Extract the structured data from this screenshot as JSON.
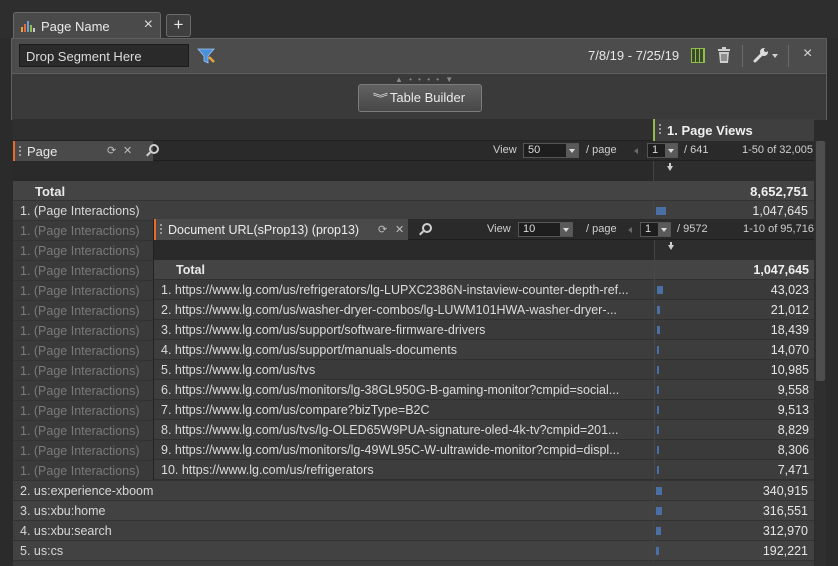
{
  "tab": {
    "title": "Page Name",
    "close": "×",
    "add": "+"
  },
  "toolbar": {
    "segment_placeholder": "Drop Segment Here",
    "date_range": "7/8/19 - 7/25/19",
    "close": "×"
  },
  "builder": {
    "grip": "▲ • • • • ▼",
    "button_label": "Table Builder"
  },
  "metric": {
    "label": "1. Page Views"
  },
  "page_dim": {
    "label": "Page",
    "view_label": "View",
    "per_page_value": "50",
    "per_page_suffix": "/ page",
    "page_value": "1",
    "page_total": "/ 641",
    "range": "1-50 of 32,005"
  },
  "total": {
    "label": "Total",
    "value": "8,652,751"
  },
  "rows_top": [
    {
      "label": "1.  (Page Interactions)",
      "value": "1,047,645",
      "bar": 0.065
    }
  ],
  "ghost_rows": [
    "1.  (Page Interactions)",
    "1.  (Page Interactions)",
    "1.  (Page Interactions)",
    "1.  (Page Interactions)",
    "1.  (Page Interactions)",
    "1.  (Page Interactions)",
    "1.  (Page Interactions)",
    "1.  (Page Interactions)",
    "1.  (Page Interactions)",
    "1.  (Page Interactions)",
    "1.  (Page Interactions)",
    "1.  (Page Interactions)",
    "1.  (Page Interactions)"
  ],
  "nested": {
    "label": "Document URL(sProp13) (prop13)",
    "view_label": "View",
    "per_page_value": "10",
    "per_page_suffix": "/ page",
    "page_value": "1",
    "page_total": "/ 9572",
    "range": "1-10 of 95,716",
    "total_label": "Total",
    "total_value": "1,047,645",
    "rows": [
      {
        "label": "1.  https://www.lg.com/us/refrigerators/lg-LUPXC2386N-instaview-counter-depth-ref...",
        "value": "43,023",
        "bar": 0.041
      },
      {
        "label": "2.  https://www.lg.com/us/washer-dryer-combos/lg-LUWM101HWA-washer-dryer-...",
        "value": "21,012",
        "bar": 0.02
      },
      {
        "label": "3.  https://www.lg.com/us/support/software-firmware-drivers",
        "value": "18,439",
        "bar": 0.018
      },
      {
        "label": "4.  https://www.lg.com/us/support/manuals-documents",
        "value": "14,070",
        "bar": 0.013
      },
      {
        "label": "5.  https://www.lg.com/us/tvs",
        "value": "10,985",
        "bar": 0.01
      },
      {
        "label": "6.  https://www.lg.com/us/monitors/lg-38GL950G-B-gaming-monitor?cmpid=social...",
        "value": "9,558",
        "bar": 0.009
      },
      {
        "label": "7.  https://www.lg.com/us/compare?bizType=B2C",
        "value": "9,513",
        "bar": 0.009
      },
      {
        "label": "8.  https://www.lg.com/us/tvs/lg-OLED65W9PUA-signature-oled-4k-tv?cmpid=201...",
        "value": "8,829",
        "bar": 0.008
      },
      {
        "label": "9.  https://www.lg.com/us/monitors/lg-49WL95C-W-ultrawide-monitor?cmpid=displ...",
        "value": "8,306",
        "bar": 0.008
      },
      {
        "label": "10.  https://www.lg.com/us/refrigerators",
        "value": "7,471",
        "bar": 0.007
      }
    ]
  },
  "rows_bottom": [
    {
      "label": "2.  us:experience-xboom",
      "value": "340,915",
      "bar": 0.04
    },
    {
      "label": "3.  us:xbu:home",
      "value": "316,551",
      "bar": 0.037
    },
    {
      "label": "4.  us:xbu:search",
      "value": "312,970",
      "bar": 0.036
    },
    {
      "label": "5.  us:cs",
      "value": "192,221",
      "bar": 0.022
    }
  ],
  "colors": {
    "accent_green": "#8fbf4a",
    "accent_orange": "#e86a2c",
    "bar_blue": "#4a6fa5"
  },
  "icons": [
    "bar-chart-icon",
    "filter-icon",
    "calendar-icon",
    "trash-icon",
    "wrench-icon",
    "close-icon",
    "refresh-icon",
    "search-icon",
    "sort-desc-icon"
  ]
}
